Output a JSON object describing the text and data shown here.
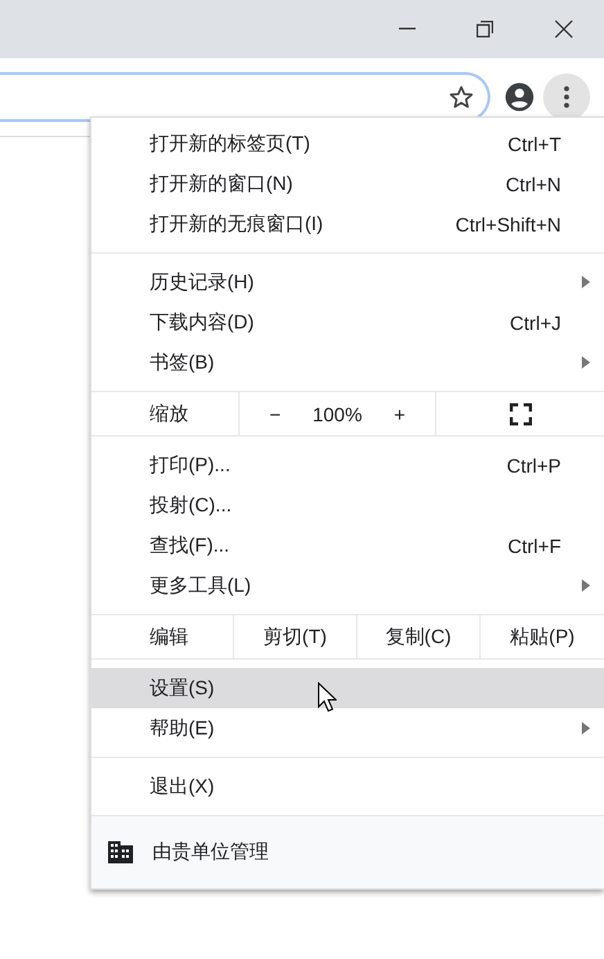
{
  "toolbar": {
    "menu_button": {
      "active": true
    }
  },
  "menu": {
    "sections": [
      {
        "items": [
          {
            "kind": "item",
            "label": "打开新的标签页(T)",
            "shortcut": "Ctrl+T",
            "submenu": false,
            "highlighted": false
          },
          {
            "kind": "item",
            "label": "打开新的窗口(N)",
            "shortcut": "Ctrl+N",
            "submenu": false,
            "highlighted": false
          },
          {
            "kind": "item",
            "label": "打开新的无痕窗口(I)",
            "shortcut": "Ctrl+Shift+N",
            "submenu": false,
            "highlighted": false
          }
        ]
      },
      {
        "items": [
          {
            "kind": "item",
            "label": "历史记录(H)",
            "submenu": true,
            "highlighted": false
          },
          {
            "kind": "item",
            "label": "下载内容(D)",
            "shortcut": "Ctrl+J",
            "submenu": false,
            "highlighted": false
          },
          {
            "kind": "item",
            "label": "书签(B)",
            "submenu": true,
            "highlighted": false
          }
        ]
      },
      {
        "items": [
          {
            "kind": "zoom",
            "label": "缩放",
            "minus": "−",
            "value": "100%",
            "plus": "+"
          }
        ]
      },
      {
        "items": [
          {
            "kind": "item",
            "label": "打印(P)...",
            "shortcut": "Ctrl+P",
            "submenu": false,
            "highlighted": false
          },
          {
            "kind": "item",
            "label": "投射(C)...",
            "submenu": false,
            "highlighted": false
          },
          {
            "kind": "item",
            "label": "查找(F)...",
            "shortcut": "Ctrl+F",
            "submenu": false,
            "highlighted": false
          },
          {
            "kind": "item",
            "label": "更多工具(L)",
            "submenu": true,
            "highlighted": false
          }
        ]
      },
      {
        "items": [
          {
            "kind": "edit",
            "label": "编辑",
            "actions": [
              "剪切(T)",
              "复制(C)",
              "粘贴(P)"
            ]
          }
        ]
      },
      {
        "items": [
          {
            "kind": "item",
            "label": "设置(S)",
            "submenu": false,
            "highlighted": true
          },
          {
            "kind": "item",
            "label": "帮助(E)",
            "submenu": true,
            "highlighted": false
          }
        ]
      },
      {
        "items": [
          {
            "kind": "item",
            "label": "退出(X)",
            "submenu": false,
            "highlighted": false
          }
        ]
      },
      {
        "items": [
          {
            "kind": "managed",
            "label": "由贵单位管理"
          }
        ]
      }
    ]
  }
}
